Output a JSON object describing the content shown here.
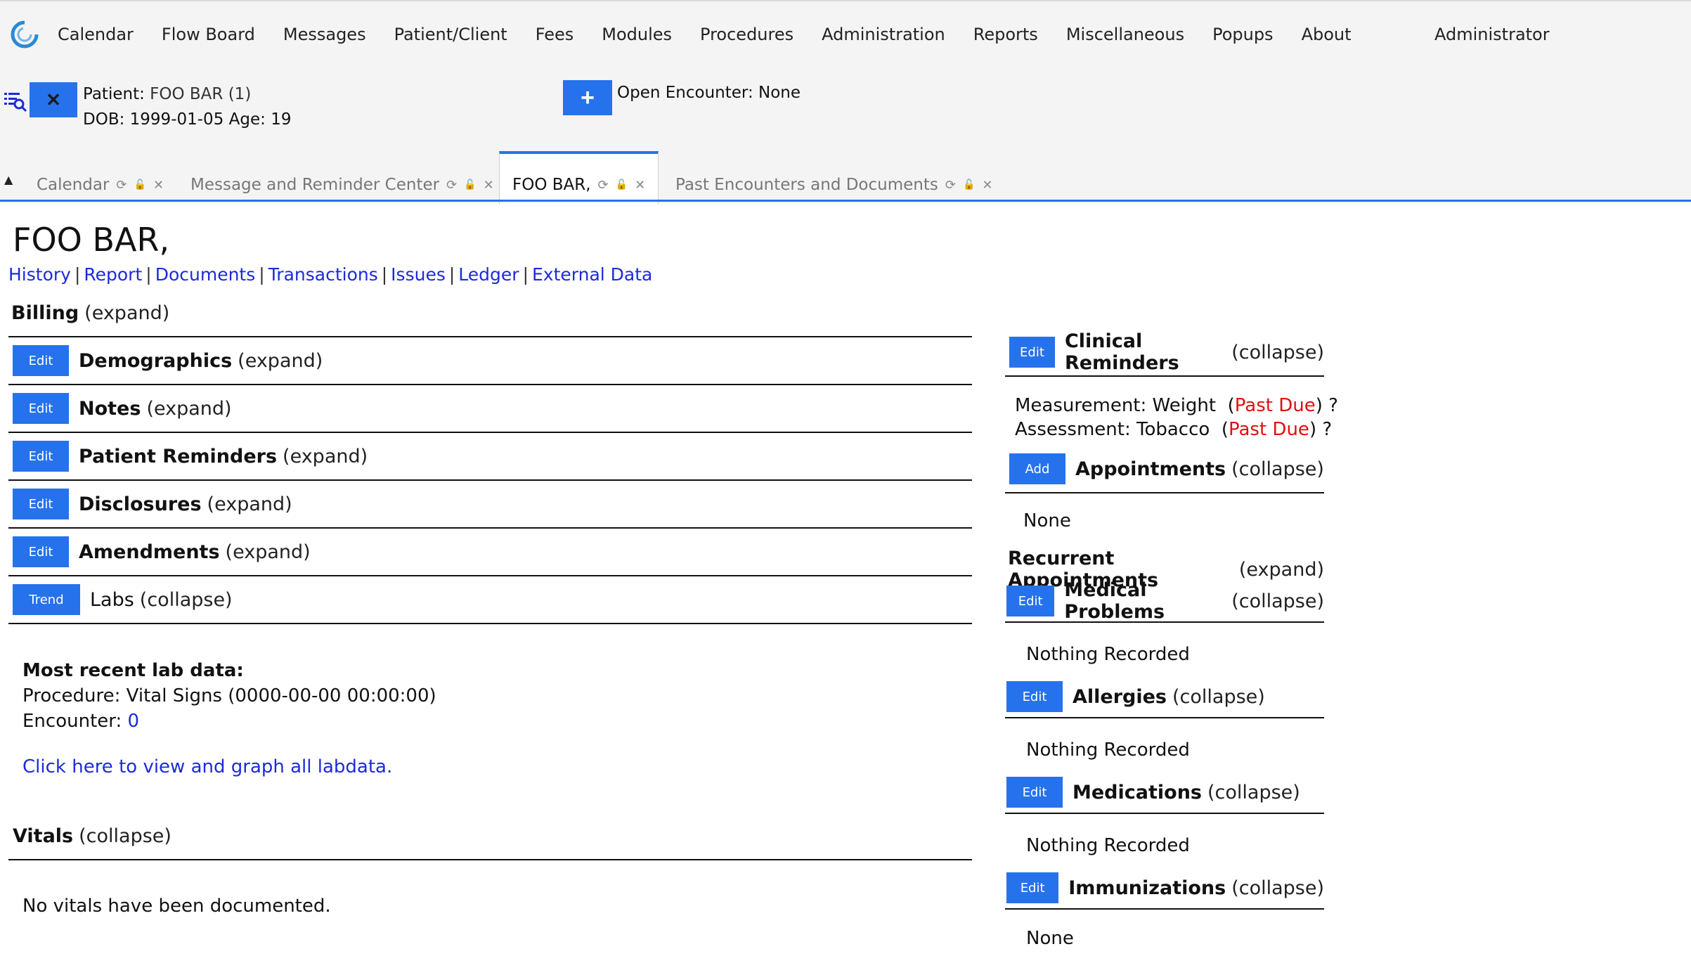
{
  "menu": {
    "items": [
      "Calendar",
      "Flow Board",
      "Messages",
      "Patient/Client",
      "Fees",
      "Modules",
      "Procedures",
      "Administration",
      "Reports",
      "Miscellaneous",
      "Popups",
      "About"
    ],
    "user": "Administrator"
  },
  "patient": {
    "label": "Patient:",
    "name": "FOO BAR (1)",
    "dob_label": "DOB:",
    "dob": "1999-01-05",
    "age_label": "Age:",
    "age": "19",
    "close_icon": "✕"
  },
  "encounter": {
    "new_icon": "+",
    "label": "Open Encounter:",
    "value": "None"
  },
  "tabs": [
    {
      "label": "Calendar"
    },
    {
      "label": "Message and Reminder Center"
    },
    {
      "label": "FOO BAR,"
    },
    {
      "label": "Past Encounters and Documents"
    }
  ],
  "icons": {
    "refresh": "⟳",
    "lock": "🔓",
    "close": "✕",
    "collapse": "▲"
  },
  "page": {
    "title": "FOO BAR,",
    "links": [
      "History",
      "Report",
      "Documents",
      "Transactions",
      "Issues",
      "Ledger",
      "External Data"
    ]
  },
  "left_sections": {
    "billing": {
      "name": "Billing",
      "toggle": "(expand)"
    },
    "demographics": {
      "name": "Demographics",
      "toggle": "(expand)",
      "button": "Edit"
    },
    "notes": {
      "name": "Notes",
      "toggle": "(expand)",
      "button": "Edit"
    },
    "patient_reminders": {
      "name": "Patient Reminders",
      "toggle": "(expand)",
      "button": "Edit"
    },
    "disclosures": {
      "name": "Disclosures",
      "toggle": "(expand)",
      "button": "Edit"
    },
    "amendments": {
      "name": "Amendments",
      "toggle": "(expand)",
      "button": "Edit"
    },
    "labs": {
      "name": "Labs",
      "toggle": "(collapse)",
      "button": "Trend"
    },
    "vitals": {
      "name": "Vitals",
      "toggle": "(collapse)"
    }
  },
  "labs": {
    "heading": "Most recent lab data:",
    "procedure": "Procedure: Vital Signs (0000-00-00 00:00:00)",
    "encounter_label": "Encounter:",
    "encounter_value": "0",
    "view_link": "Click here to view and graph all labdata."
  },
  "vitals": {
    "message": "No vitals have been documented."
  },
  "right_sections": {
    "clinical_reminders": {
      "name": "Clinical Reminders",
      "toggle": "(collapse)",
      "button": "Edit"
    },
    "appointments": {
      "name": "Appointments",
      "toggle": "(collapse)",
      "button": "Add"
    },
    "recurrent_appointments": {
      "name": "Recurrent Appointments",
      "toggle": "(expand)"
    },
    "medical_problems": {
      "name": "Medical Problems",
      "toggle": "(collapse)",
      "button": "Edit"
    },
    "allergies": {
      "name": "Allergies",
      "toggle": "(collapse)",
      "button": "Edit"
    },
    "medications": {
      "name": "Medications",
      "toggle": "(collapse)",
      "button": "Edit"
    },
    "immunizations": {
      "name": "Immunizations",
      "toggle": "(collapse)",
      "button": "Edit"
    }
  },
  "clinical_reminders": {
    "items": [
      {
        "text": "Measurement: Weight",
        "status": "Past Due",
        "help": "?"
      },
      {
        "text": "Assessment: Tobacco",
        "status": "Past Due",
        "help": "?"
      }
    ]
  },
  "right_values": {
    "appointments": "None",
    "medical_problems": "Nothing Recorded",
    "allergies": "Nothing Recorded",
    "medications": "Nothing Recorded",
    "immunizations": "None"
  },
  "colors": {
    "accent": "#2672ec",
    "link": "#1c2bd9",
    "past_due": "#e01010"
  }
}
